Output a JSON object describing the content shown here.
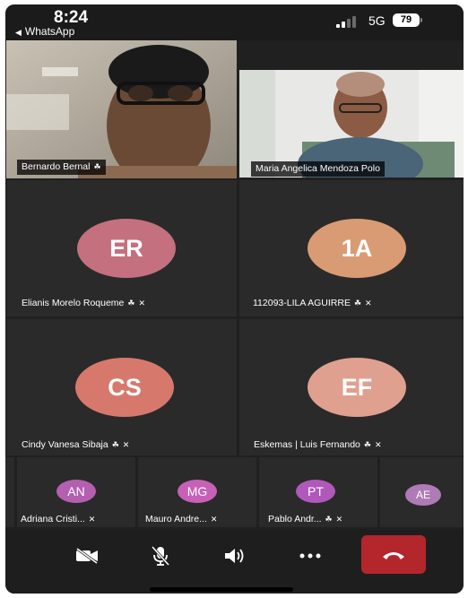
{
  "status_bar": {
    "time": "8:24",
    "back_app": "WhatsApp",
    "network": "5G",
    "battery": "79"
  },
  "video_tiles": [
    {
      "name": "Bernardo Bernal"
    },
    {
      "name": "Maria Angelica Mendoza Polo"
    }
  ],
  "avatar_tiles": [
    {
      "initials": "ER",
      "name": "Elianis Morelo Roqueme",
      "color": "#c4707f"
    },
    {
      "initials": "1A",
      "name": "112093-LILA AGUIRRE",
      "color": "#d99b74"
    },
    {
      "initials": "CS",
      "name": "Cindy Vanesa Sibaja",
      "color": "#d6796c"
    },
    {
      "initials": "EF",
      "name": "Eskemas | Luis Fernando",
      "color": "#e0a090"
    }
  ],
  "strip_tiles": [
    {
      "initials": "AN",
      "name": "Adriana Cristi...",
      "color": "#b55fb0"
    },
    {
      "initials": "MG",
      "name": "Mauro Andre...",
      "color": "#c860b8"
    },
    {
      "initials": "PT",
      "name": "Pablo Andr...",
      "color": "#b158bb"
    },
    {
      "initials": "AE",
      "name": "",
      "color": "#b07ab8"
    }
  ],
  "controls": [
    {
      "icon": "camera-off-icon"
    },
    {
      "icon": "mic-off-icon"
    },
    {
      "icon": "speaker-icon"
    },
    {
      "icon": "more-icon"
    },
    {
      "icon": "hang-up-icon"
    }
  ],
  "colors": {
    "background": "#202020",
    "tile": "#2a2a2a",
    "hangup": "#b3262c"
  }
}
